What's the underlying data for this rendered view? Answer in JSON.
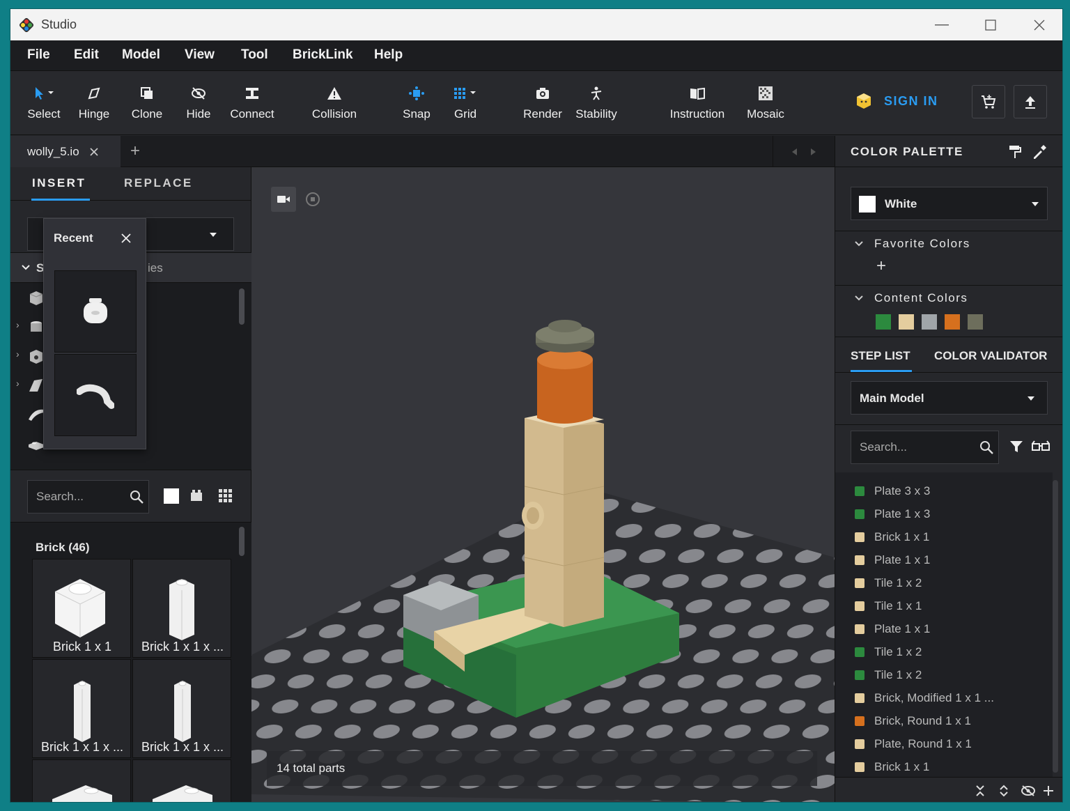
{
  "window": {
    "title": "Studio"
  },
  "menu": [
    "File",
    "Edit",
    "Model",
    "View",
    "Tool",
    "BrickLink",
    "Help"
  ],
  "toolbar": {
    "select": "Select",
    "hinge": "Hinge",
    "clone": "Clone",
    "hide": "Hide",
    "connect": "Connect",
    "collision": "Collision",
    "snap": "Snap",
    "grid": "Grid",
    "render": "Render",
    "stability": "Stability",
    "instruction": "Instruction",
    "mosaic": "Mosaic",
    "sign_in": "SIGN IN"
  },
  "file_tab": {
    "name": "wolly_5.io",
    "add": "+"
  },
  "left_panel": {
    "tabs": {
      "insert": "INSERT",
      "replace": "REPLACE"
    },
    "category_header": "S",
    "category_suffix": "ies",
    "recent_popup": {
      "title": "Recent"
    },
    "search_placeholder": "Search...",
    "group_title": "Brick (46)",
    "parts": [
      "Brick 1 x 1",
      "Brick 1 x 1 x ...",
      "Brick 1 x 1 x ...",
      "Brick 1 x 1 x ..."
    ]
  },
  "viewport": {
    "status": "14 total parts"
  },
  "right_panel": {
    "color_palette_title": "COLOR PALETTE",
    "selected_color": "White",
    "favorite_colors_title": "Favorite Colors",
    "favorite_add": "+",
    "content_colors_title": "Content Colors",
    "content_colors": [
      "#2c8a3e",
      "#e4cd9e",
      "#a0a5a9",
      "#d6701e",
      "#6d6e5c"
    ],
    "tabs": {
      "step_list": "STEP LIST",
      "color_validator": "COLOR VALIDATOR"
    },
    "model_select": "Main Model",
    "search_placeholder": "Search...",
    "steps": [
      {
        "name": "Plate 3 x 3",
        "color": "#2c8a3e"
      },
      {
        "name": "Plate 1 x 3",
        "color": "#2c8a3e"
      },
      {
        "name": "Brick 1 x 1",
        "color": "#e4cd9e"
      },
      {
        "name": "Plate 1 x 1",
        "color": "#e4cd9e"
      },
      {
        "name": "Tile 1 x 2",
        "color": "#e4cd9e"
      },
      {
        "name": "Tile 1 x 1",
        "color": "#e4cd9e"
      },
      {
        "name": "Plate 1 x 1",
        "color": "#e4cd9e"
      },
      {
        "name": "Tile 1 x 2",
        "color": "#2c8a3e"
      },
      {
        "name": "Tile 1 x 2",
        "color": "#2c8a3e"
      },
      {
        "name": "Brick, Modified 1 x 1 ...",
        "color": "#e4cd9e"
      },
      {
        "name": "Brick, Round  1 x 1",
        "color": "#d6701e"
      },
      {
        "name": "Plate, Round 1 x 1",
        "color": "#e4cd9e"
      },
      {
        "name": "Brick 1 x 1",
        "color": "#e4cd9e"
      }
    ]
  }
}
